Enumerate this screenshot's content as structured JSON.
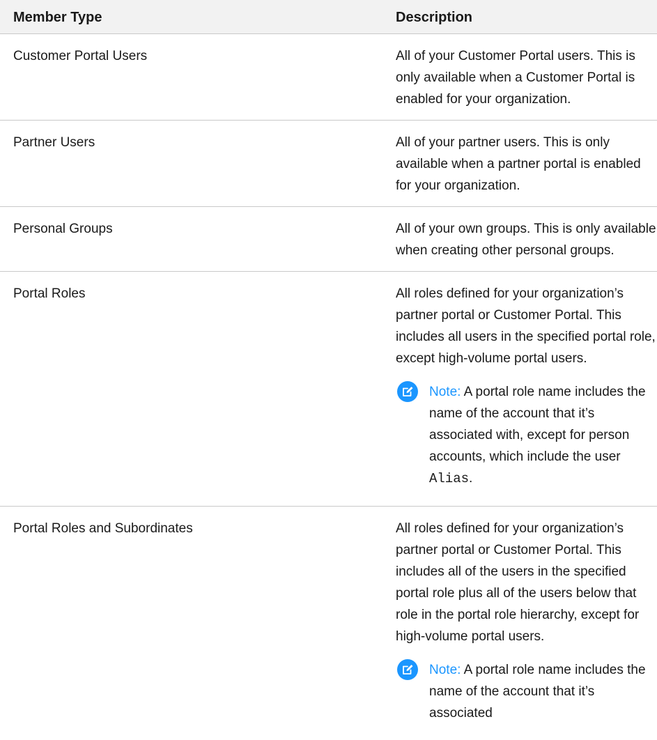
{
  "table": {
    "headers": {
      "member_type": "Member Type",
      "description": "Description"
    },
    "rows": [
      {
        "type": "Customer Portal Users",
        "description": "All of your Customer Portal users. This is only available when a Customer Portal is enabled for your organization."
      },
      {
        "type": "Partner Users",
        "description": "All of your partner users. This is only available when a partner portal is enabled for your organization."
      },
      {
        "type": "Personal Groups",
        "description": "All of your own groups. This is only available when creating other personal groups."
      },
      {
        "type": "Portal Roles",
        "description": "All roles defined for your organization’s partner portal or Customer Portal. This includes all users in the specified portal role, except high-volume portal users.",
        "note": {
          "label": "Note:",
          "text_before": "A portal role name includes the name of the account that it’s associated with, except for person accounts, which include the user",
          "code": "Alias",
          "text_after": "."
        }
      },
      {
        "type": "Portal Roles and Subordinates",
        "description": "All roles defined for your organization’s partner portal or Customer Portal. This includes all of the users in the specified portal role plus all of the users below that role in the portal role hierarchy, except for high-volume portal users.",
        "note": {
          "label": "Note:",
          "text_before": "A portal role name includes the name of the account that it’s associated"
        }
      }
    ]
  },
  "colors": {
    "note_accent": "#1b96ff",
    "header_bg": "#f2f2f2",
    "divider": "#c9c9c9"
  },
  "icons": {
    "note": "edit-note-icon"
  }
}
